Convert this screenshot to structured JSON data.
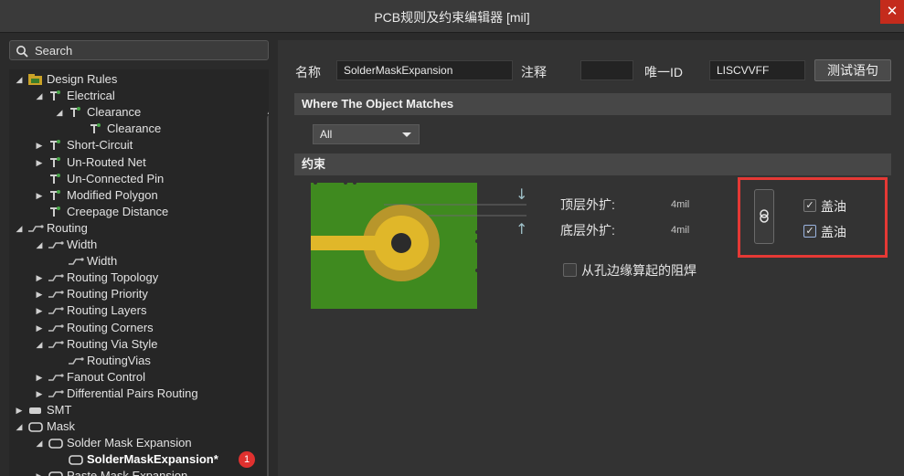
{
  "window": {
    "title": "PCB规则及约束编辑器 [mil]",
    "close_glyph": "✕"
  },
  "search": {
    "placeholder": "Search"
  },
  "tree": {
    "items": [
      {
        "label": "Design Rules",
        "icon": "design-rules-folder-icon",
        "arrow": "◢",
        "selected": false
      },
      {
        "label": "Electrical",
        "icon": "electrical-rule-icon",
        "arrow": "◢",
        "selected": false
      },
      {
        "label": "Clearance",
        "icon": "electrical-rule-icon",
        "arrow": "◢",
        "selected": false
      },
      {
        "label": "Clearance",
        "icon": "electrical-rule-icon",
        "arrow": "",
        "selected": false
      },
      {
        "label": "Short-Circuit",
        "icon": "electrical-rule-icon",
        "arrow": "▶",
        "selected": false
      },
      {
        "label": "Un-Routed Net",
        "icon": "electrical-rule-icon",
        "arrow": "▶",
        "selected": false
      },
      {
        "label": "Un-Connected Pin",
        "icon": "electrical-rule-icon",
        "arrow": "",
        "selected": false
      },
      {
        "label": "Modified Polygon",
        "icon": "electrical-rule-icon",
        "arrow": "▶",
        "selected": false
      },
      {
        "label": "Creepage Distance",
        "icon": "electrical-rule-icon",
        "arrow": "",
        "selected": false
      },
      {
        "label": "Routing",
        "icon": "routing-rule-icon",
        "arrow": "◢",
        "selected": false
      },
      {
        "label": "Width",
        "icon": "routing-rule-icon",
        "arrow": "◢",
        "selected": false
      },
      {
        "label": "Width",
        "icon": "routing-rule-icon",
        "arrow": "",
        "selected": false
      },
      {
        "label": "Routing Topology",
        "icon": "routing-rule-icon",
        "arrow": "▶",
        "selected": false
      },
      {
        "label": "Routing Priority",
        "icon": "routing-rule-icon",
        "arrow": "▶",
        "selected": false
      },
      {
        "label": "Routing Layers",
        "icon": "routing-rule-icon",
        "arrow": "▶",
        "selected": false
      },
      {
        "label": "Routing Corners",
        "icon": "routing-rule-icon",
        "arrow": "▶",
        "selected": false
      },
      {
        "label": "Routing Via Style",
        "icon": "routing-rule-icon",
        "arrow": "◢",
        "selected": false
      },
      {
        "label": "RoutingVias",
        "icon": "routing-rule-icon",
        "arrow": "",
        "selected": false
      },
      {
        "label": "Fanout Control",
        "icon": "routing-rule-icon",
        "arrow": "▶",
        "selected": false
      },
      {
        "label": "Differential Pairs Routing",
        "icon": "routing-rule-icon",
        "arrow": "▶",
        "selected": false
      },
      {
        "label": "SMT",
        "icon": "smt-rule-icon",
        "arrow": "▶",
        "selected": false
      },
      {
        "label": "Mask",
        "icon": "mask-rule-icon",
        "arrow": "◢",
        "selected": false
      },
      {
        "label": "Solder Mask Expansion",
        "icon": "mask-rule-icon",
        "arrow": "◢",
        "selected": false
      },
      {
        "label": "SolderMaskExpansion*",
        "icon": "mask-rule-icon",
        "arrow": "",
        "selected": true,
        "badge": "1"
      },
      {
        "label": "Paste Mask Expansion",
        "icon": "mask-rule-icon",
        "arrow": "▶",
        "selected": false
      }
    ]
  },
  "rule": {
    "name_label": "名称",
    "name_value": "SolderMaskExpansion",
    "comment_label": "注释",
    "comment_value": "",
    "id_label": "唯一ID",
    "id_value": "LISCVVFF",
    "test_button": "测试语句"
  },
  "match": {
    "section_title": "Where The Object Matches",
    "scope_value": "All"
  },
  "constraints": {
    "section_title": "约束",
    "top_label": "顶层外扩:",
    "top_value": "4mil",
    "bottom_label": "底层外扩:",
    "bottom_value": "4mil",
    "from_hole_label": "从孔边缘算起的阻焊",
    "from_hole_checked": false,
    "top_tent_label": "盖油",
    "top_tent_checked": true,
    "bottom_tent_label": "盖油",
    "bottom_tent_checked": true,
    "check_glyph": "✓",
    "link_icon": "link-icon"
  },
  "colors": {
    "pcb_green": "#3f8a1f",
    "pad_gold": "#e0b729",
    "mask_ring": "#b8962b",
    "highlight_red": "#e53935"
  }
}
